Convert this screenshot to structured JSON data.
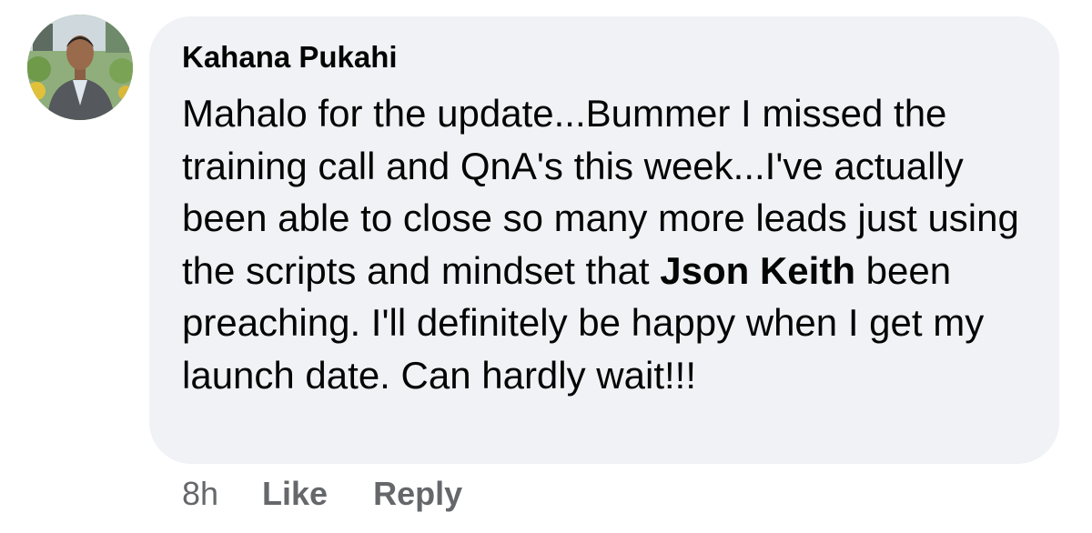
{
  "comment": {
    "author": "Kahana Pukahi",
    "body": {
      "before_mention": "Mahalo for the update...Bummer I missed the training call and QnA's this week...I've actually been able to close so many more leads just using the scripts and mindset that ",
      "mention": "Json Keith",
      "after_mention": " been preaching. I'll definitely be happy when I get my launch date. Can hardly wait!!!"
    },
    "timestamp": "8h",
    "actions": {
      "like_label": "Like",
      "reply_label": "Reply"
    }
  },
  "colors": {
    "bubble_background": "#f0f2f5",
    "text": "#050505",
    "secondary_text": "#65676b"
  }
}
